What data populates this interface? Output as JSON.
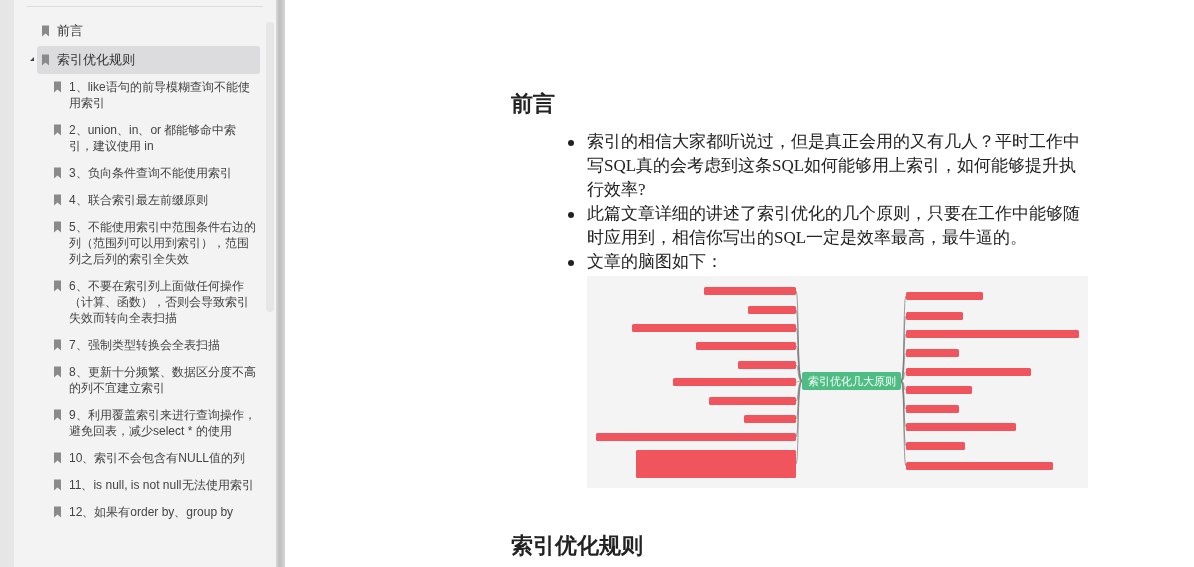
{
  "sidebar": {
    "items": [
      {
        "label": "前言",
        "selected": false
      },
      {
        "label": "索引优化规则",
        "selected": true,
        "expanded": true,
        "children": [
          {
            "label": "1、like语句的前导模糊查询不能使用索引"
          },
          {
            "label": "2、union、in、or 都能够命中索引，建议使用 in"
          },
          {
            "label": "3、负向条件查询不能使用索引"
          },
          {
            "label": "4、联合索引最左前缀原则"
          },
          {
            "label": "5、不能使用索引中范围条件右边的列（范围列可以用到索引），范围列之后列的索引全失效"
          },
          {
            "label": "6、不要在索引列上面做任何操作（计算、函数），否则会导致索引失效而转向全表扫描"
          },
          {
            "label": "7、强制类型转换会全表扫描"
          },
          {
            "label": "8、更新十分频繁、数据区分度不高的列不宜建立索引"
          },
          {
            "label": "9、利用覆盖索引来进行查询操作，避免回表，减少select * 的使用"
          },
          {
            "label": "10、索引不会包含有NULL值的列"
          },
          {
            "label": "11、is null, is not null无法使用索引"
          },
          {
            "label": "12、如果有order by、group by"
          }
        ]
      }
    ]
  },
  "article": {
    "sections": [
      {
        "heading": "前言",
        "bullets": [
          "索引的相信大家都听说过，但是真正会用的又有几人？平时工作中写SQL真的会考虑到这条SQL如何能够用上索引，如何能够提升执行效率?",
          "此篇文章详细的讲述了索引优化的几个原则，只要在工作中能够随时应用到，相信你写出的SQL一定是效率最高，最牛逼的。",
          "文章的脑图如下："
        ],
        "mind_map": {
          "root": "索引优化几大原则"
        }
      },
      {
        "heading": "索引优化规则"
      }
    ]
  }
}
